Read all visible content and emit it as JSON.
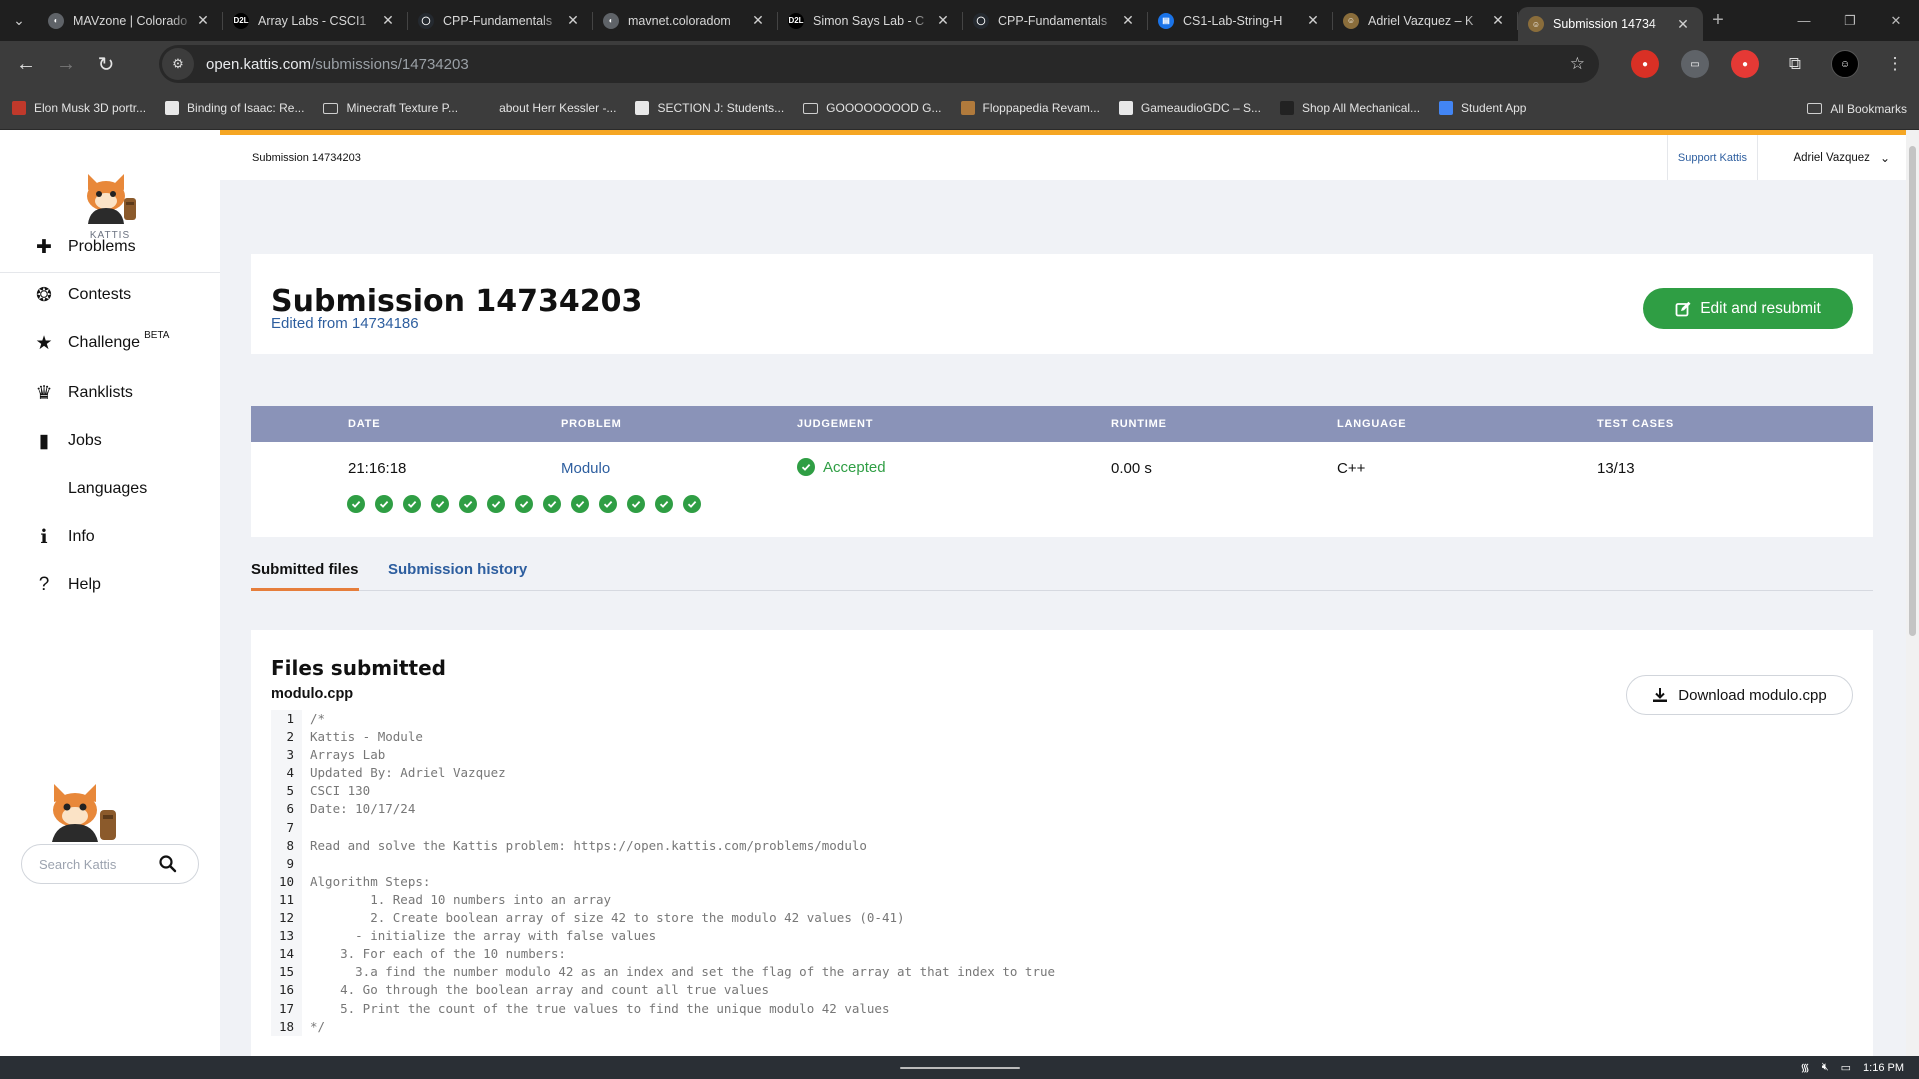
{
  "browser": {
    "tabs": [
      {
        "title": "MAVzone | Colorado",
        "color": "#5f6368",
        "glyph": "◐"
      },
      {
        "title": "Array Labs - CSCI1",
        "color": "#000000",
        "glyph": "D2L"
      },
      {
        "title": "CPP-Fundamentals",
        "color": "#24292f",
        "glyph": "◯"
      },
      {
        "title": "mavnet.coloradom",
        "color": "#5f6368",
        "glyph": "◐"
      },
      {
        "title": "Simon Says Lab - C",
        "color": "#000000",
        "glyph": "D2L"
      },
      {
        "title": "CPP-Fundamentals",
        "color": "#24292f",
        "glyph": "◯"
      },
      {
        "title": "CS1-Lab-String-H",
        "color": "#1a73e8",
        "glyph": "▤"
      },
      {
        "title": "Adriel Vazquez – K",
        "color": "#8a6d3b",
        "glyph": "☺"
      },
      {
        "title": "Submission 14734",
        "color": "#8a6d3b",
        "glyph": "☺"
      }
    ],
    "url_host": "open.kattis.com",
    "url_path": "/submissions/14734203",
    "bookmarks": [
      {
        "label": "Elon Musk 3D portr...",
        "kind": "icon",
        "color": "#c0392b"
      },
      {
        "label": "Binding of Isaac: Re...",
        "kind": "icon",
        "color": "#e8e8e8"
      },
      {
        "label": "Minecraft Texture P...",
        "kind": "folder"
      },
      {
        "label": "about Herr Kessler -...",
        "kind": "icon",
        "color": "#3c3c3c"
      },
      {
        "label": "SECTION J: Students...",
        "kind": "icon",
        "color": "#e8e8e8"
      },
      {
        "label": "GOOOOOOOOD G...",
        "kind": "folder"
      },
      {
        "label": "Floppapedia Revam...",
        "kind": "icon",
        "color": "#b07a3c"
      },
      {
        "label": "GameaudioGDC – S...",
        "kind": "icon",
        "color": "#e8e8e8"
      },
      {
        "label": "Shop All Mechanical...",
        "kind": "icon",
        "color": "#222222"
      },
      {
        "label": "Student App",
        "kind": "icon",
        "color": "#4285f4"
      }
    ],
    "all_bookmarks": "All Bookmarks"
  },
  "sidebar": {
    "logo_text": "KATTIS",
    "nav": [
      {
        "label": "Problems",
        "icon": "puzzle-icon"
      },
      {
        "label": "Contests",
        "icon": "medal-icon"
      },
      {
        "label": "Challenge",
        "icon": "star-icon",
        "badge": "BETA"
      },
      {
        "label": "Ranklists",
        "icon": "trophy-icon"
      },
      {
        "label": "Jobs",
        "icon": "briefcase-icon"
      },
      {
        "label": "Languages",
        "icon": "code-icon"
      },
      {
        "label": "Info",
        "icon": "info-icon"
      },
      {
        "label": "Help",
        "icon": "help-icon"
      }
    ],
    "search_placeholder": "Search Kattis"
  },
  "topbar": {
    "breadcrumb": "Submission 14734203",
    "support": "Support Kattis",
    "user": "Adriel Vazquez"
  },
  "header": {
    "title": "Submission 14734203",
    "edited_from": "Edited from 14734186",
    "resubmit": "Edit and resubmit"
  },
  "results": {
    "columns": [
      "DATE",
      "PROBLEM",
      "JUDGEMENT",
      "RUNTIME",
      "LANGUAGE",
      "TEST CASES"
    ],
    "row": {
      "date": "21:16:18",
      "problem": "Modulo",
      "judgement": "Accepted",
      "runtime": "0.00 s",
      "language": "C++",
      "test_cases": "13/13"
    },
    "test_case_count": 13,
    "accent": "#2f9e44"
  },
  "tabs": {
    "submitted_files": "Submitted files",
    "submission_history": "Submission history"
  },
  "files": {
    "heading": "Files submitted",
    "filename": "modulo.cpp",
    "download": "Download modulo.cpp",
    "code_lines": [
      "/*",
      "Kattis - Module",
      "Arrays Lab",
      "Updated By: Adriel Vazquez",
      "CSCI 130",
      "Date: 10/17/24",
      "",
      "Read and solve the Kattis problem: https://open.kattis.com/problems/modulo",
      "",
      "Algorithm Steps:",
      "        1. Read 10 numbers into an array",
      "        2. Create boolean array of size 42 to store the modulo 42 values (0-41)",
      "      - initialize the array with false values",
      "    3. For each of the 10 numbers:",
      "      3.a find the number modulo 42 as an index and set the flag of the array at that index to true",
      "    4. Go through the boolean array and count all true values",
      "    5. Print the count of the true values to find the unique modulo 42 values",
      "*/"
    ]
  },
  "taskbar": {
    "time": "1:16 PM"
  }
}
